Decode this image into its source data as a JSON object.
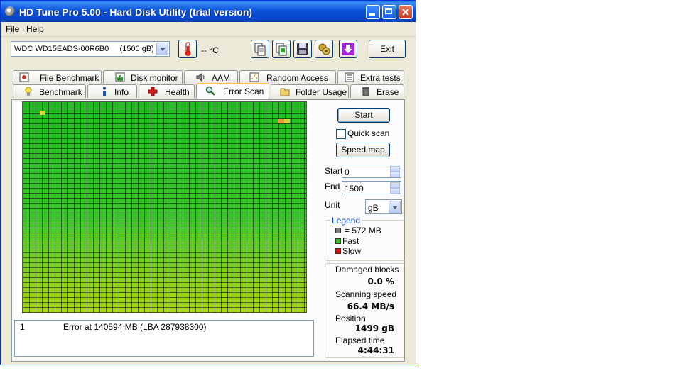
{
  "window": {
    "title": "HD Tune Pro 5.00 - Hard Disk Utility (trial version)"
  },
  "menu": [
    {
      "label": "File"
    },
    {
      "label": "Help"
    }
  ],
  "toolbar": {
    "drive": "WDC WD15EADS-00R6B0     (1500 gB)",
    "temperature": "-- °C",
    "exit_label": "Exit"
  },
  "tabs_top": [
    {
      "label": "File Benchmark",
      "icon": "file-benchmark-icon"
    },
    {
      "label": "Disk monitor",
      "icon": "disk-monitor-icon"
    },
    {
      "label": "AAM",
      "icon": "speaker-icon"
    },
    {
      "label": "Random Access",
      "icon": "random-access-icon"
    },
    {
      "label": "Extra tests",
      "icon": "extra-tests-icon"
    }
  ],
  "tabs_bottom": [
    {
      "label": "Benchmark",
      "icon": "lightbulb-icon"
    },
    {
      "label": "Info",
      "icon": "info-icon"
    },
    {
      "label": "Health",
      "icon": "health-cross-icon"
    },
    {
      "label": "Error Scan",
      "icon": "magnifier-icon",
      "active": true
    },
    {
      "label": "Folder Usage",
      "icon": "folder-icon"
    },
    {
      "label": "Erase",
      "icon": "trash-icon"
    }
  ],
  "controls": {
    "start_button": "Start",
    "quick_scan_label": "Quick scan",
    "quick_scan_checked": false,
    "speed_map_button": "Speed map",
    "start_label": "Start",
    "start_value": "0",
    "end_label": "End",
    "end_value": "1500",
    "unit_label": "Unit",
    "unit_value": "gB"
  },
  "legend": {
    "title": "Legend",
    "items": [
      {
        "label": "= 572 MB",
        "color": "#808080"
      },
      {
        "label": "Fast",
        "color": "#22cc22"
      },
      {
        "label": "Slow",
        "color": "#dd1111"
      }
    ]
  },
  "stats": {
    "damaged_label": "Damaged blocks",
    "damaged_value": "0.0 %",
    "speed_label": "Scanning speed",
    "speed_value": "66.4 MB/s",
    "position_label": "Position",
    "position_value": "1499 gB",
    "elapsed_label": "Elapsed time",
    "elapsed_value": "4:44:31"
  },
  "error_log": [
    {
      "index": "1",
      "message": "Error at 140594 MB (LBA 287938300)"
    }
  ],
  "colors": {
    "scan_fast": "#2fc41f",
    "scan_marker": "#e6d23c",
    "title_bar": "#0a54dc"
  }
}
